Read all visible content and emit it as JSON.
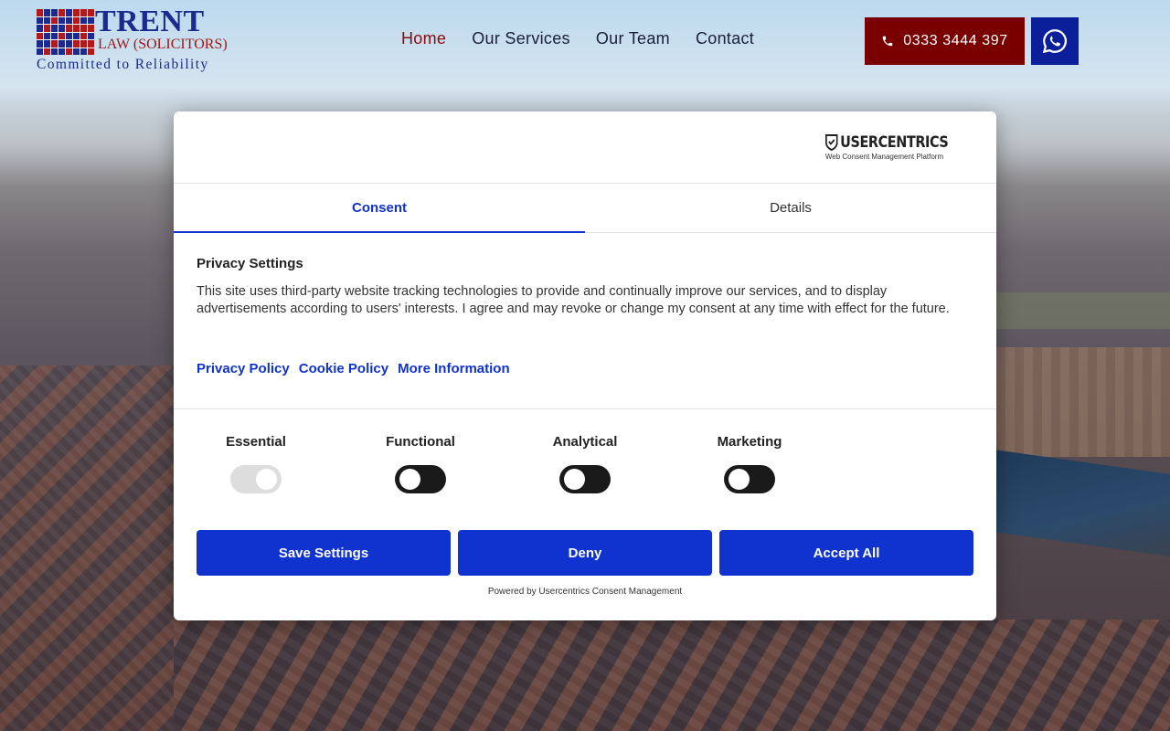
{
  "header": {
    "logo": {
      "name": "TRENT",
      "subtitle": "LAW (SOLICITORS)",
      "tagline": "Committed to Reliability"
    },
    "nav": [
      {
        "label": "Home",
        "active": true
      },
      {
        "label": "Our Services",
        "active": false
      },
      {
        "label": "Our Team",
        "active": false
      },
      {
        "label": "Contact",
        "active": false
      }
    ],
    "phone": "0333 3444 397",
    "whatsapp_icon": "whatsapp-icon"
  },
  "consent": {
    "brand": "USERCENTRICS",
    "brand_sub": "Web Consent Management Platform",
    "tabs": [
      {
        "label": "Consent",
        "active": true
      },
      {
        "label": "Details",
        "active": false
      }
    ],
    "title": "Privacy Settings",
    "text": "This site uses third-party website tracking technologies to provide and continually improve our services, and to display advertisements according to users' interests. I agree and may revoke or change my consent at any time with effect for the future.",
    "links": [
      "Privacy Policy",
      "Cookie Policy",
      "More Information"
    ],
    "categories": [
      {
        "label": "Essential",
        "enabled": true,
        "locked": true
      },
      {
        "label": "Functional",
        "enabled": false,
        "locked": false
      },
      {
        "label": "Analytical",
        "enabled": false,
        "locked": false
      },
      {
        "label": "Marketing",
        "enabled": false,
        "locked": false
      }
    ],
    "buttons": {
      "save": "Save Settings",
      "deny": "Deny",
      "accept": "Accept All"
    },
    "powered_by": "Powered by Usercentrics Consent Management"
  },
  "colors": {
    "brand_blue": "#1a2a8f",
    "brand_red": "#7a0000",
    "whatsapp_bg": "#0c1f9a",
    "consent_accent": "#1032cf"
  }
}
